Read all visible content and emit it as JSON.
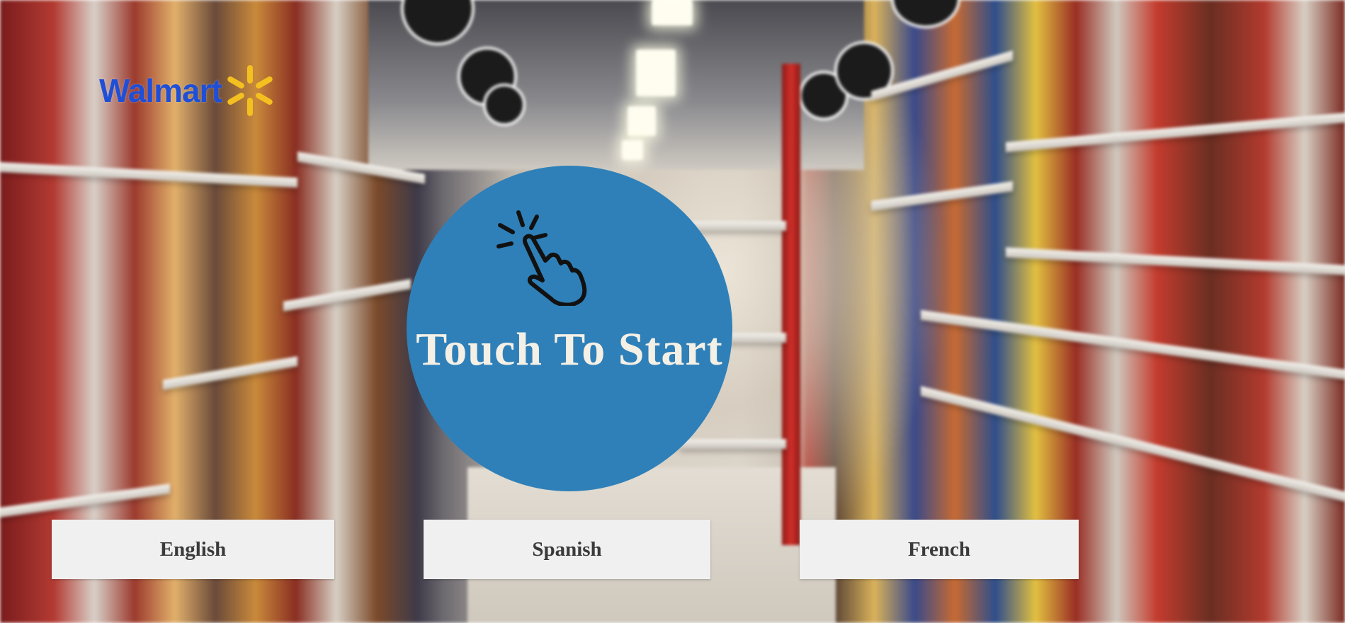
{
  "logo": {
    "text": "Walmart",
    "text_color": "#1f4fd6",
    "spark_color": "#f4c020"
  },
  "start": {
    "label": "Touch To Start",
    "icon": "tap-hand-icon",
    "circle_color": "#2f80b8",
    "text_color": "#f5f0e6"
  },
  "languages": {
    "english": "English",
    "spanish": "Spanish",
    "french": "French"
  },
  "background": {
    "description_icon": "grocery-aisle-photo"
  }
}
